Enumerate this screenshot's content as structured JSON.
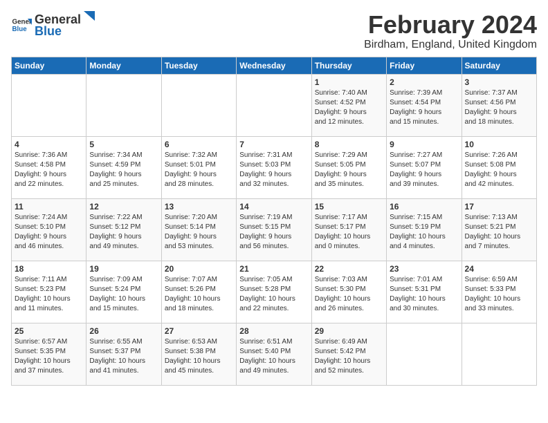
{
  "header": {
    "logo_general": "General",
    "logo_blue": "Blue",
    "month_title": "February 2024",
    "location": "Birdham, England, United Kingdom"
  },
  "days_of_week": [
    "Sunday",
    "Monday",
    "Tuesday",
    "Wednesday",
    "Thursday",
    "Friday",
    "Saturday"
  ],
  "weeks": [
    [
      {
        "day": "",
        "info": ""
      },
      {
        "day": "",
        "info": ""
      },
      {
        "day": "",
        "info": ""
      },
      {
        "day": "",
        "info": ""
      },
      {
        "day": "1",
        "info": "Sunrise: 7:40 AM\nSunset: 4:52 PM\nDaylight: 9 hours\nand 12 minutes."
      },
      {
        "day": "2",
        "info": "Sunrise: 7:39 AM\nSunset: 4:54 PM\nDaylight: 9 hours\nand 15 minutes."
      },
      {
        "day": "3",
        "info": "Sunrise: 7:37 AM\nSunset: 4:56 PM\nDaylight: 9 hours\nand 18 minutes."
      }
    ],
    [
      {
        "day": "4",
        "info": "Sunrise: 7:36 AM\nSunset: 4:58 PM\nDaylight: 9 hours\nand 22 minutes."
      },
      {
        "day": "5",
        "info": "Sunrise: 7:34 AM\nSunset: 4:59 PM\nDaylight: 9 hours\nand 25 minutes."
      },
      {
        "day": "6",
        "info": "Sunrise: 7:32 AM\nSunset: 5:01 PM\nDaylight: 9 hours\nand 28 minutes."
      },
      {
        "day": "7",
        "info": "Sunrise: 7:31 AM\nSunset: 5:03 PM\nDaylight: 9 hours\nand 32 minutes."
      },
      {
        "day": "8",
        "info": "Sunrise: 7:29 AM\nSunset: 5:05 PM\nDaylight: 9 hours\nand 35 minutes."
      },
      {
        "day": "9",
        "info": "Sunrise: 7:27 AM\nSunset: 5:07 PM\nDaylight: 9 hours\nand 39 minutes."
      },
      {
        "day": "10",
        "info": "Sunrise: 7:26 AM\nSunset: 5:08 PM\nDaylight: 9 hours\nand 42 minutes."
      }
    ],
    [
      {
        "day": "11",
        "info": "Sunrise: 7:24 AM\nSunset: 5:10 PM\nDaylight: 9 hours\nand 46 minutes."
      },
      {
        "day": "12",
        "info": "Sunrise: 7:22 AM\nSunset: 5:12 PM\nDaylight: 9 hours\nand 49 minutes."
      },
      {
        "day": "13",
        "info": "Sunrise: 7:20 AM\nSunset: 5:14 PM\nDaylight: 9 hours\nand 53 minutes."
      },
      {
        "day": "14",
        "info": "Sunrise: 7:19 AM\nSunset: 5:15 PM\nDaylight: 9 hours\nand 56 minutes."
      },
      {
        "day": "15",
        "info": "Sunrise: 7:17 AM\nSunset: 5:17 PM\nDaylight: 10 hours\nand 0 minutes."
      },
      {
        "day": "16",
        "info": "Sunrise: 7:15 AM\nSunset: 5:19 PM\nDaylight: 10 hours\nand 4 minutes."
      },
      {
        "day": "17",
        "info": "Sunrise: 7:13 AM\nSunset: 5:21 PM\nDaylight: 10 hours\nand 7 minutes."
      }
    ],
    [
      {
        "day": "18",
        "info": "Sunrise: 7:11 AM\nSunset: 5:23 PM\nDaylight: 10 hours\nand 11 minutes."
      },
      {
        "day": "19",
        "info": "Sunrise: 7:09 AM\nSunset: 5:24 PM\nDaylight: 10 hours\nand 15 minutes."
      },
      {
        "day": "20",
        "info": "Sunrise: 7:07 AM\nSunset: 5:26 PM\nDaylight: 10 hours\nand 18 minutes."
      },
      {
        "day": "21",
        "info": "Sunrise: 7:05 AM\nSunset: 5:28 PM\nDaylight: 10 hours\nand 22 minutes."
      },
      {
        "day": "22",
        "info": "Sunrise: 7:03 AM\nSunset: 5:30 PM\nDaylight: 10 hours\nand 26 minutes."
      },
      {
        "day": "23",
        "info": "Sunrise: 7:01 AM\nSunset: 5:31 PM\nDaylight: 10 hours\nand 30 minutes."
      },
      {
        "day": "24",
        "info": "Sunrise: 6:59 AM\nSunset: 5:33 PM\nDaylight: 10 hours\nand 33 minutes."
      }
    ],
    [
      {
        "day": "25",
        "info": "Sunrise: 6:57 AM\nSunset: 5:35 PM\nDaylight: 10 hours\nand 37 minutes."
      },
      {
        "day": "26",
        "info": "Sunrise: 6:55 AM\nSunset: 5:37 PM\nDaylight: 10 hours\nand 41 minutes."
      },
      {
        "day": "27",
        "info": "Sunrise: 6:53 AM\nSunset: 5:38 PM\nDaylight: 10 hours\nand 45 minutes."
      },
      {
        "day": "28",
        "info": "Sunrise: 6:51 AM\nSunset: 5:40 PM\nDaylight: 10 hours\nand 49 minutes."
      },
      {
        "day": "29",
        "info": "Sunrise: 6:49 AM\nSunset: 5:42 PM\nDaylight: 10 hours\nand 52 minutes."
      },
      {
        "day": "",
        "info": ""
      },
      {
        "day": "",
        "info": ""
      }
    ]
  ]
}
